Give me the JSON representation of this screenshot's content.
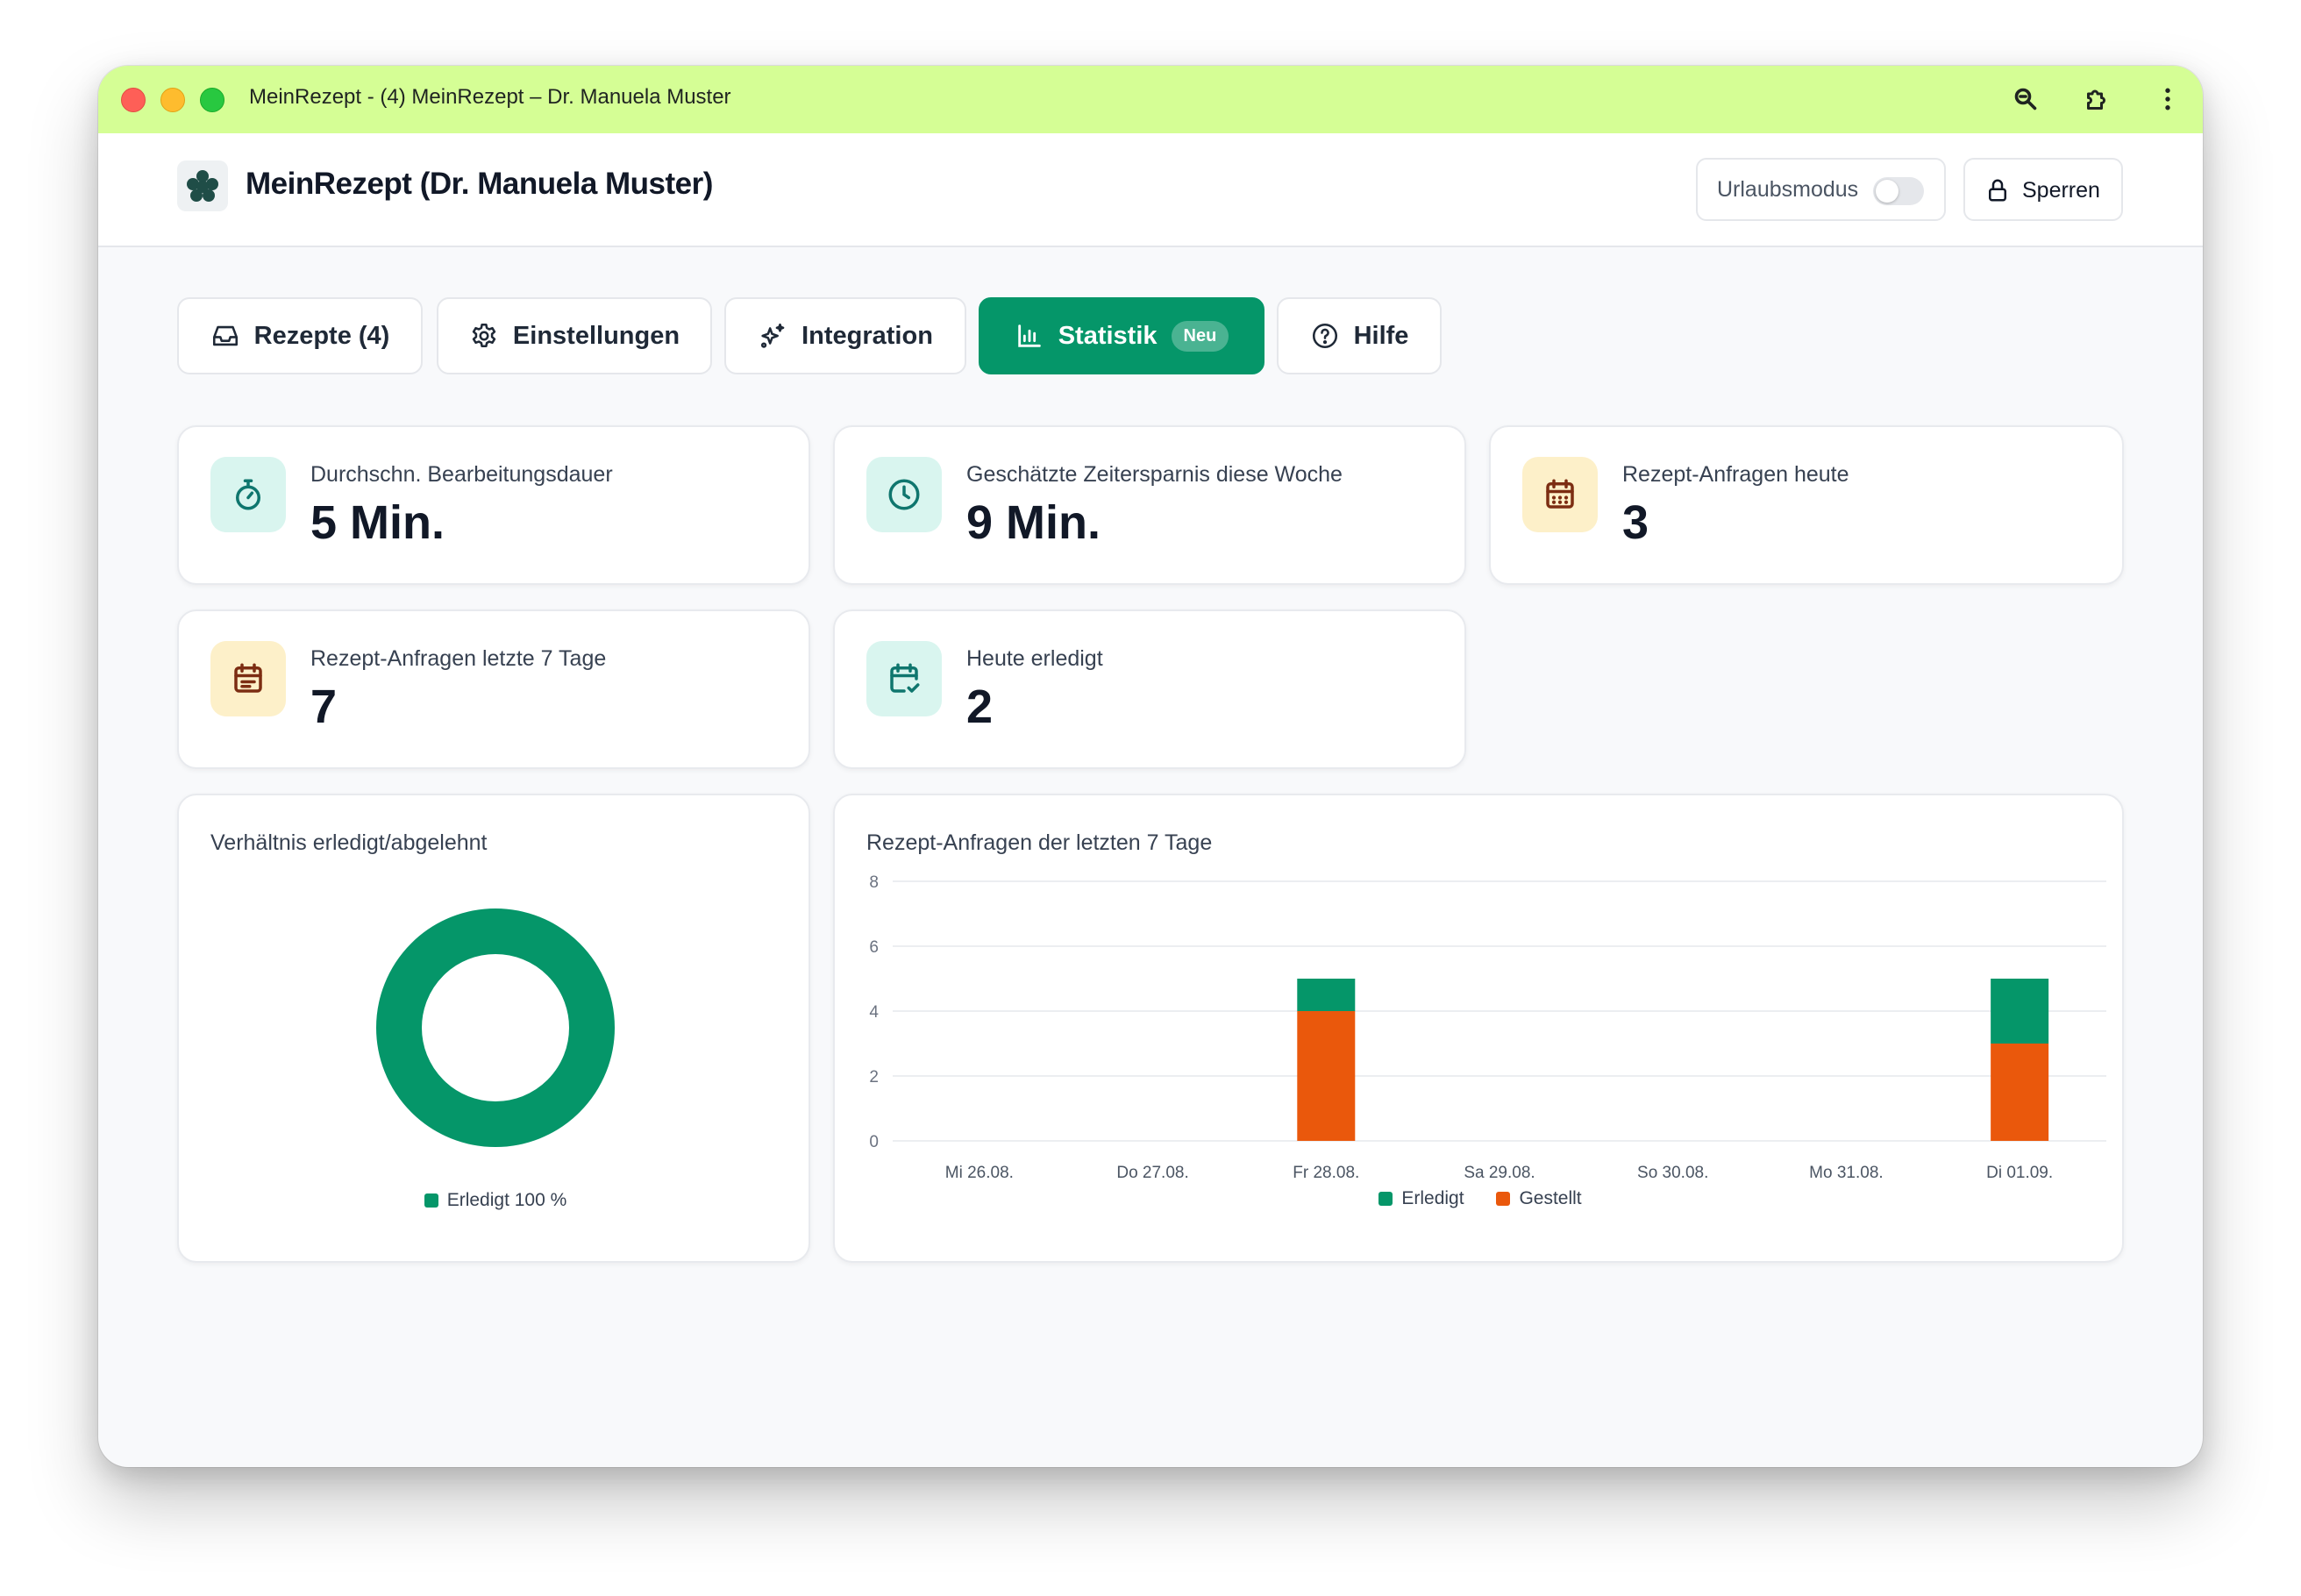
{
  "window": {
    "title": "MeinRezept - (4) MeinRezept – Dr. Manuela Muster",
    "titlebar_color": "#d5fe95"
  },
  "header": {
    "app_title": "MeinRezept (Dr. Manuela Muster)",
    "vacation_label": "Urlaubsmodus",
    "vacation_on": false,
    "lock_label": "Sperren"
  },
  "tabs": [
    {
      "label": "Rezepte (4)",
      "icon": "inbox-icon",
      "active": false
    },
    {
      "label": "Einstellungen",
      "icon": "gear-icon",
      "active": false
    },
    {
      "label": "Integration",
      "icon": "sparkles-icon",
      "active": false
    },
    {
      "label": "Statistik",
      "icon": "bar-chart-icon",
      "active": true,
      "badge": "Neu"
    },
    {
      "label": "Hilfe",
      "icon": "help-circle-icon",
      "active": false
    }
  ],
  "stats": [
    {
      "label": "Durchschn. Bearbeitungsdauer",
      "value": "5 Min.",
      "icon": "timer-icon"
    },
    {
      "label": "Geschätzte Zeitersparnis diese Woche",
      "value": "9 Min.",
      "icon": "clock-icon"
    },
    {
      "label": "Rezept-Anfragen heute",
      "value": "3",
      "icon": "calendar-icon"
    },
    {
      "label": "Rezept-Anfragen letzte 7 Tage",
      "value": "7",
      "icon": "calendar-list-icon"
    },
    {
      "label": "Heute erledigt",
      "value": "2",
      "icon": "calendar-check-icon"
    }
  ],
  "colors": {
    "accent": "#059669",
    "erledigt": "#059669",
    "gestellt": "#ea580c"
  },
  "chart_data": [
    {
      "type": "pie",
      "title": "Verhältnis erledigt/abgelehnt",
      "categories": [
        "Erledigt"
      ],
      "values": [
        100
      ],
      "legend": [
        "Erledigt 100 %"
      ],
      "legend_position": "bottom"
    },
    {
      "type": "bar",
      "title": "Rezept-Anfragen der letzten 7 Tage",
      "categories": [
        "Mi 26.08.",
        "Do 27.08.",
        "Fr 28.08.",
        "Sa 29.08.",
        "So 30.08.",
        "Mo 31.08.",
        "Di 01.09."
      ],
      "stacked": true,
      "series": [
        {
          "name": "Gestellt",
          "values": [
            0,
            0,
            4,
            0,
            0,
            0,
            3
          ]
        },
        {
          "name": "Erledigt",
          "values": [
            0,
            0,
            1,
            0,
            0,
            0,
            2
          ]
        }
      ],
      "yticks": [
        "0",
        "2",
        "4",
        "6",
        "8"
      ],
      "ylim": [
        0,
        8
      ],
      "grid": true,
      "legend_position": "bottom",
      "xlabel": "",
      "ylabel": ""
    }
  ]
}
